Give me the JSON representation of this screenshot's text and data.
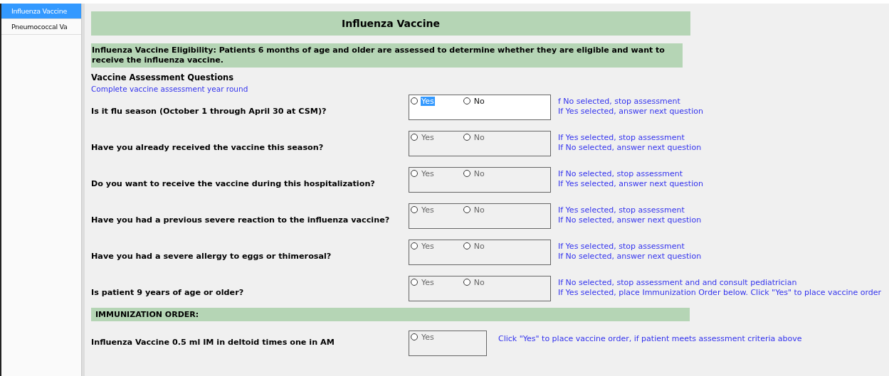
{
  "sidebar": {
    "items": [
      {
        "label": "Influenza Vaccine",
        "selected": true
      },
      {
        "label": "Pneumococcal Va",
        "selected": false
      }
    ]
  },
  "form": {
    "title": "Influenza Vaccine",
    "eligibility": "Influenza Vaccine Eligibility: Patients 6 months of age and older are assessed to determine whether they are eligible and want to receive the influenza vaccine.",
    "section_title": "Vaccine Assessment Questions",
    "section_note": "Complete vaccine assessment year round",
    "questions": [
      {
        "text": "Is it flu season (October 1 through April 30 at CSM)?",
        "disabled": false,
        "options": [
          {
            "label": "Yes",
            "selected": false,
            "focused": true
          },
          {
            "label": "No",
            "selected": false,
            "focused": false
          }
        ],
        "hints": [
          "f No selected, stop assessment",
          "If Yes selected, answer next question"
        ]
      },
      {
        "text": "Have you already received the vaccine this season?",
        "disabled": true,
        "options": [
          {
            "label": "Yes",
            "selected": false,
            "focused": false
          },
          {
            "label": "No",
            "selected": false,
            "focused": false
          }
        ],
        "hints": [
          "If Yes selected, stop assessment",
          "If No selected, answer next question"
        ]
      },
      {
        "text": "Do you want to receive the vaccine during this hospitalization?",
        "disabled": true,
        "options": [
          {
            "label": "Yes",
            "selected": false,
            "focused": false
          },
          {
            "label": "No",
            "selected": false,
            "focused": false
          }
        ],
        "hints": [
          "If No selected, stop assessment",
          "If Yes selected, answer next question"
        ]
      },
      {
        "text": "Have you had a previous severe reaction to the influenza vaccine?",
        "disabled": true,
        "options": [
          {
            "label": "Yes",
            "selected": false,
            "focused": false
          },
          {
            "label": "No",
            "selected": false,
            "focused": false
          }
        ],
        "hints": [
          "If Yes selected, stop assessment",
          "If No selected, answer next question"
        ]
      },
      {
        "text": "Have you had a severe allergy to eggs or thimerosal?",
        "disabled": true,
        "options": [
          {
            "label": "Yes",
            "selected": false,
            "focused": false
          },
          {
            "label": "No",
            "selected": false,
            "focused": false
          }
        ],
        "hints": [
          "If Yes selected, stop assessment",
          "If No selected, answer next question"
        ]
      },
      {
        "text": "Is patient 9 years of age or older?",
        "disabled": true,
        "options": [
          {
            "label": "Yes",
            "selected": false,
            "focused": false
          },
          {
            "label": "No",
            "selected": false,
            "focused": false
          }
        ],
        "hints": [
          "If No selected, stop assessment and and consult pediatrician",
          "If Yes selected, place Immunization Order below. Click \"Yes\" to place vaccine order"
        ]
      }
    ],
    "order_title": "IMMUNIZATION ORDER:",
    "order": {
      "text": "Influenza Vaccine 0.5 ml IM in deltoid times one in AM",
      "disabled": true,
      "options": [
        {
          "label": "Yes",
          "selected": false,
          "focused": false
        }
      ],
      "hints": [
        "Click \"Yes\" to place vaccine order, if patient meets assessment criteria above"
      ]
    }
  }
}
